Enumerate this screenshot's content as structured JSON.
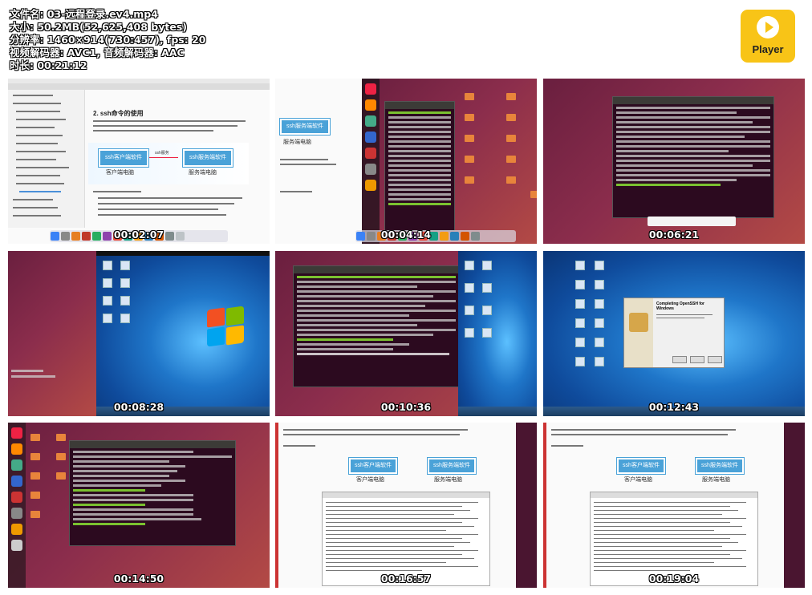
{
  "file_info": {
    "filename": "文件名: 03-远程登录.ev4.mp4",
    "size": "大小: 50.2MB(52,625,408 bytes)",
    "resolution": "分辨率: 1460×914(730:457), fps: 20",
    "codec": "视频解码器: AVC1, 音频解码器: AAC",
    "duration": "时长: 00:21:12"
  },
  "player_logo": {
    "label": "Player",
    "icon": "play-icon",
    "color": "#f8c417"
  },
  "thumbnails": [
    {
      "timestamp": "00:02:07",
      "scene": "mac-browser-doc",
      "heading": "2. ssh命令的使用",
      "client_label": "ssh客户端软件",
      "client_caption": "客户端电脑",
      "server_label": "ssh服务端软件",
      "server_caption": "服务端电脑",
      "arrow_label": "ssh服务"
    },
    {
      "timestamp": "00:04:14",
      "scene": "ubuntu-terminal",
      "server_label": "ssh服务端软件",
      "server_caption": "服务端电脑"
    },
    {
      "timestamp": "00:06:21",
      "scene": "ubuntu-terminal-wide"
    },
    {
      "timestamp": "00:08:28",
      "scene": "windows7-desktop"
    },
    {
      "timestamp": "00:10:36",
      "scene": "ubuntu-terminal-ifconfig"
    },
    {
      "timestamp": "00:12:43",
      "scene": "windows7-installer",
      "dialog_title": "Completing OpenSSH for Windows"
    },
    {
      "timestamp": "00:14:50",
      "scene": "ubuntu-terminal-who"
    },
    {
      "timestamp": "00:16:57",
      "scene": "mac-doc-terminal",
      "client_label": "ssh客户端软件",
      "client_caption": "客户端电脑",
      "server_label": "ssh服务端软件",
      "server_caption": "服务端电脑"
    },
    {
      "timestamp": "00:19:04",
      "scene": "mac-doc-terminal",
      "client_label": "ssh客户端软件",
      "client_caption": "客户端电脑",
      "server_label": "ssh服务端软件",
      "server_caption": "服务端电脑"
    }
  ]
}
